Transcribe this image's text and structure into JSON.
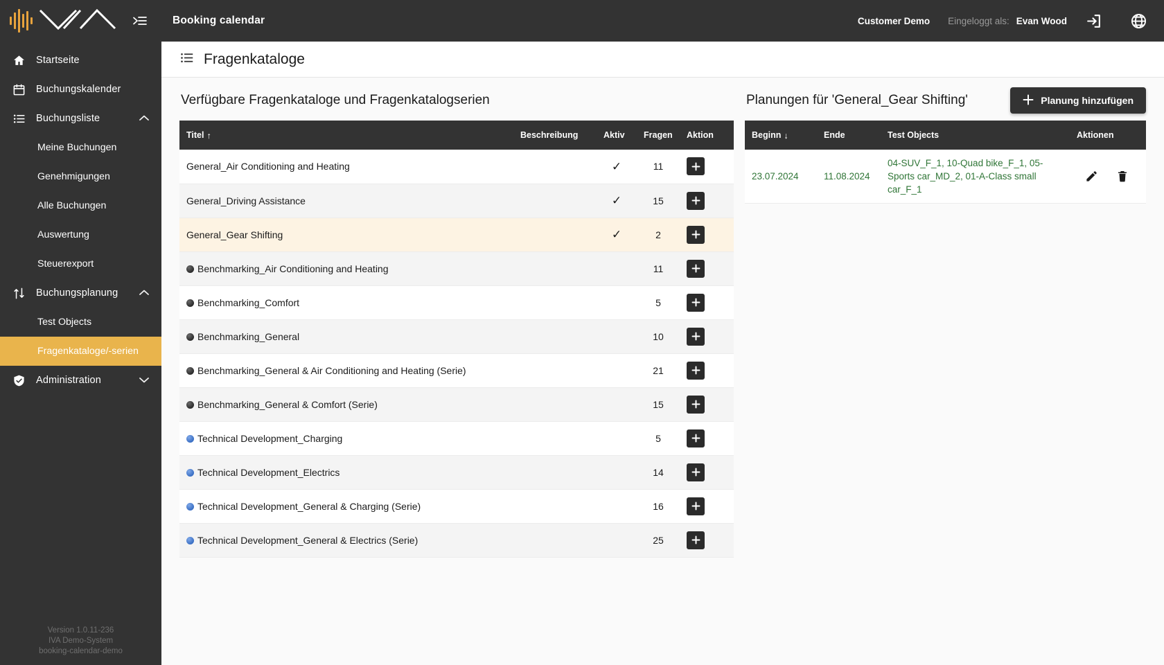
{
  "sidebar": {
    "logo_alt": "IVA logo",
    "collapse_label": "",
    "items": [
      {
        "label": "Startseite",
        "icon": "home-icon",
        "type": "item"
      },
      {
        "label": "Buchungskalender",
        "icon": "calendar-icon",
        "type": "item"
      },
      {
        "label": "Buchungsliste",
        "icon": "list-icon",
        "type": "group",
        "expanded": true
      },
      {
        "label": "Meine Buchungen",
        "type": "sub"
      },
      {
        "label": "Genehmigungen",
        "type": "sub"
      },
      {
        "label": "Alle Buchungen",
        "type": "sub"
      },
      {
        "label": "Auswertung",
        "type": "sub"
      },
      {
        "label": "Steuerexport",
        "type": "sub"
      },
      {
        "label": "Buchungsplanung",
        "icon": "swap-icon",
        "type": "group",
        "expanded": true
      },
      {
        "label": "Test Objects",
        "type": "sub"
      },
      {
        "label": "Fragenkataloge/-serien",
        "type": "sub",
        "active": true
      },
      {
        "label": "Administration",
        "icon": "shield-check-icon",
        "type": "group",
        "expanded": false
      }
    ],
    "footer": {
      "version": "Version 1.0.11-236",
      "system": "IVA Demo-System",
      "instance": "booking-calendar-demo"
    }
  },
  "topbar": {
    "app_title": "Booking calendar",
    "customer": "Customer Demo",
    "logged_in_label": "Eingeloggt als:",
    "username": "Evan Wood",
    "logout_icon": "logout-icon",
    "language_icon": "globe-icon"
  },
  "page": {
    "title": "Fragenkataloge",
    "title_icon": "list-icon"
  },
  "left_panel": {
    "heading": "Verfügbare Fragenkataloge und Fragenkatalogserien",
    "columns": {
      "title": "Titel",
      "description": "Beschreibung",
      "active": "Aktiv",
      "questions": "Fragen",
      "action": "Aktion"
    },
    "sort_column": "Titel",
    "sort_direction": "asc",
    "rows": [
      {
        "marker": "none",
        "title": "General_Air Conditioning and Heating",
        "description": "",
        "active": true,
        "questions": "11",
        "action_icon": "plus-icon",
        "highlighted": false
      },
      {
        "marker": "none",
        "title": "General_Driving Assistance",
        "description": "",
        "active": true,
        "questions": "15",
        "action_icon": "plus-icon",
        "highlighted": false
      },
      {
        "marker": "none",
        "title": "General_Gear Shifting",
        "description": "",
        "active": true,
        "questions": "2",
        "action_icon": "plus-icon",
        "highlighted": true
      },
      {
        "marker": "dark",
        "title": "Benchmarking_Air Conditioning and Heating",
        "description": "",
        "active": false,
        "questions": "11",
        "action_icon": "plus-icon",
        "highlighted": false
      },
      {
        "marker": "dark",
        "title": "Benchmarking_Comfort",
        "description": "",
        "active": false,
        "questions": "5",
        "action_icon": "plus-icon",
        "highlighted": false
      },
      {
        "marker": "dark",
        "title": "Benchmarking_General",
        "description": "",
        "active": false,
        "questions": "10",
        "action_icon": "plus-icon",
        "highlighted": false
      },
      {
        "marker": "dark",
        "title": "Benchmarking_General & Air Conditioning and Heating (Serie)",
        "description": "",
        "active": false,
        "questions": "21",
        "action_icon": "plus-icon",
        "highlighted": false
      },
      {
        "marker": "dark",
        "title": "Benchmarking_General & Comfort (Serie)",
        "description": "",
        "active": false,
        "questions": "15",
        "action_icon": "plus-icon",
        "highlighted": false
      },
      {
        "marker": "blue",
        "title": "Technical Development_Charging",
        "description": "",
        "active": false,
        "questions": "5",
        "action_icon": "plus-icon",
        "highlighted": false
      },
      {
        "marker": "blue",
        "title": "Technical Development_Electrics",
        "description": "",
        "active": false,
        "questions": "14",
        "action_icon": "plus-icon",
        "highlighted": false
      },
      {
        "marker": "blue",
        "title": "Technical Development_General & Charging (Serie)",
        "description": "",
        "active": false,
        "questions": "16",
        "action_icon": "plus-icon",
        "highlighted": false
      },
      {
        "marker": "blue",
        "title": "Technical Development_General & Electrics (Serie)",
        "description": "",
        "active": false,
        "questions": "25",
        "action_icon": "plus-icon",
        "highlighted": false
      }
    ]
  },
  "right_panel": {
    "heading": "Planungen für 'General_Gear Shifting'",
    "add_button": "Planung hinzufügen",
    "add_button_icon": "plus-icon",
    "columns": {
      "start": "Beginn",
      "end": "Ende",
      "test_objects": "Test Objects",
      "actions": "Aktionen"
    },
    "sort_column": "Beginn",
    "sort_direction": "desc",
    "rows": [
      {
        "start": "23.07.2024",
        "end": "11.08.2024",
        "test_objects": "04-SUV_F_1, 10-Quad bike_F_1, 05-Sports car_MD_2, 01-A-Class small car_F_1",
        "edit_icon": "pencil-icon",
        "delete_icon": "trash-icon"
      }
    ]
  },
  "colors": {
    "sidebar_bg": "#333333",
    "accent": "#e9b44c",
    "logo_accent": "#e8a33d",
    "row_highlight": "#fdf3e3",
    "green_text": "#2f7536",
    "header_dark": "#333333"
  }
}
